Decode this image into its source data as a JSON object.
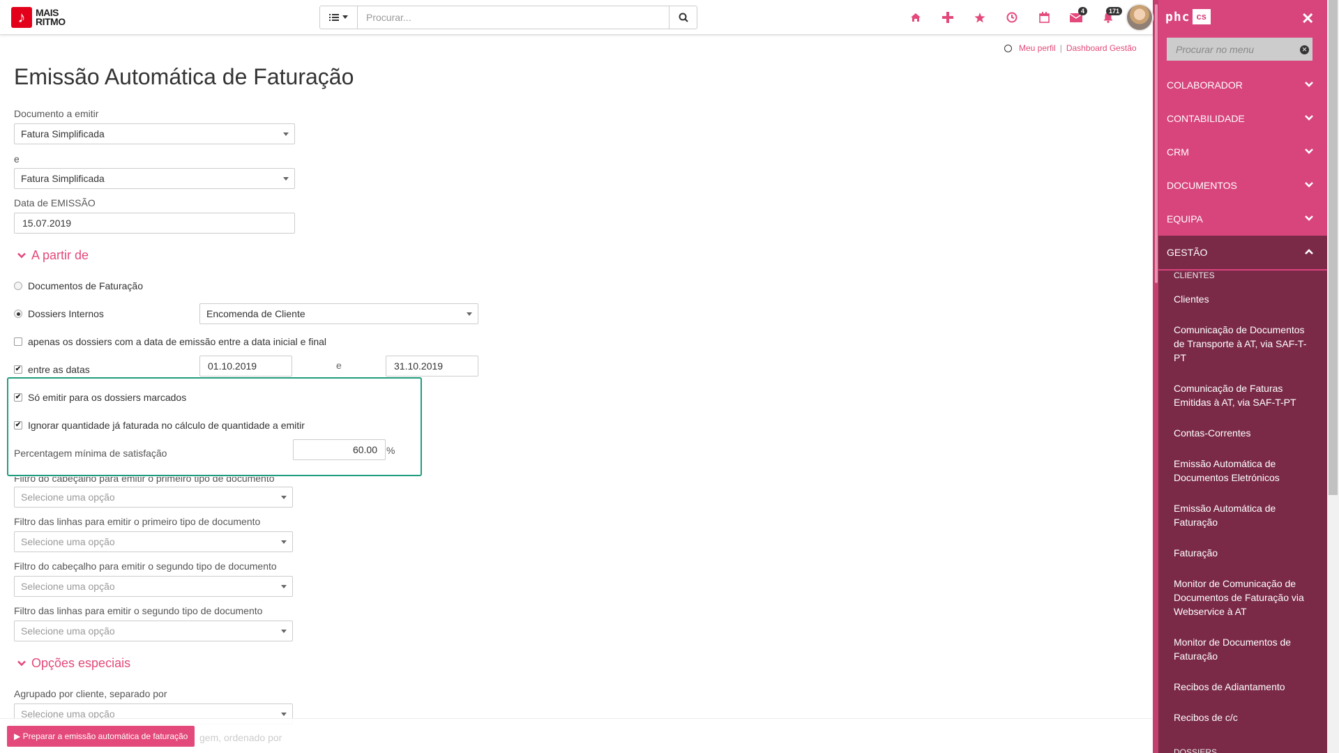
{
  "header": {
    "logo_line1": "MAIS",
    "logo_line2": "RITMO",
    "search_placeholder": "Procurar...",
    "badges": {
      "messages": "4",
      "notifications": "171"
    },
    "links": {
      "profile": "Meu perfil",
      "separator": "|",
      "dashboard": "Dashboard Gestão"
    },
    "accent_color": "#e3497a"
  },
  "page": {
    "title": "Emissão Automática de Faturação",
    "doc_label": "Documento a emitir",
    "doc_value": "Fatura Simplificada",
    "and_label": "e",
    "doc2_value": "Fatura Simplificada",
    "date_label": "Data de EMISSÃO",
    "date_value": "15.07.2019"
  },
  "from_section": {
    "title": "A partir de",
    "radio_docs": "Documentos de Faturação",
    "radio_dossiers": "Dossiers Internos",
    "dossier_type": "Encomenda de Cliente",
    "only_dates_label": "apenas os dossiers com a data de emissão entre a data inicial e final",
    "between_label": "entre as datas",
    "date_from": "01.10.2019",
    "date_and": "e",
    "date_to": "31.10.2019",
    "only_marked": "Só emitir para os dossiers marcados",
    "ignore_qty": "Ignorar quantidade já faturada no cálculo de quantidade a emitir",
    "min_pct_label": "Percentagem mínima de satisfação",
    "min_pct_value": "60.00",
    "pct_sign": "%",
    "filter1_label": "Filtro do cabeçalho para emitir o primeiro tipo de documento",
    "filter2_label": "Filtro das linhas para emitir o primeiro tipo de documento",
    "filter3_label": "Filtro do cabeçalho para emitir o segundo tipo de documento",
    "filter4_label": "Filtro das linhas para emitir o segundo tipo de documento",
    "select_placeholder": "Selecione uma opção"
  },
  "special_section": {
    "title": "Opções especiais",
    "group_label": "Agrupado por cliente, separado por",
    "select_placeholder": "Selecione uma opção",
    "ghost_label": "gem, ordenado por"
  },
  "footer": {
    "primary_button": "▶ Preparar a emissão automática de faturação"
  },
  "sidebar": {
    "brand": "phc",
    "brand_box": "cs",
    "close": "✕",
    "search_placeholder": "Procurar no menu",
    "color": "#d8447c",
    "categories": [
      "COLABORADOR",
      "CONTABILIDADE",
      "CRM",
      "DOCUMENTOS",
      "EQUIPA",
      "GESTÃO"
    ],
    "group": "CLIENTES",
    "items": [
      "Clientes",
      "Comunicação de Documentos de Transporte à AT, via SAF-T-PT",
      "Comunicação de Faturas Emitidas à AT, via SAF-T-PT",
      "Contas-Correntes",
      "Emissão Automática de Documentos Eletrónicos",
      "Emissão Automática de Faturação",
      "Faturação",
      "Monitor de Comunicação de Documentos de Faturação via Webservice à AT",
      "Monitor de Documentos de Faturação",
      "Recibos de Adiantamento",
      "Recibos de c/c"
    ],
    "next_group": "DOSSIERS"
  }
}
